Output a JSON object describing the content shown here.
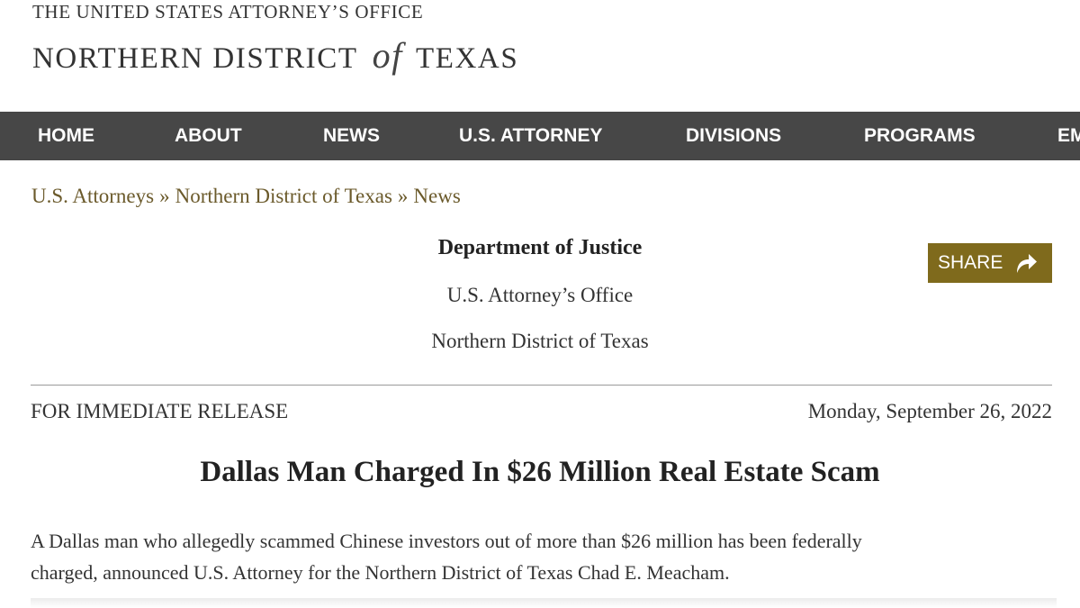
{
  "header": {
    "office_line": "THE UNITED STATES ATTORNEY’S OFFICE",
    "district_before": "NORTHERN DISTRICT",
    "district_of": "of",
    "district_after": "TEXAS"
  },
  "nav": {
    "items": [
      {
        "label": "HOME"
      },
      {
        "label": "ABOUT"
      },
      {
        "label": "NEWS"
      },
      {
        "label": "U.S. ATTORNEY"
      },
      {
        "label": "DIVISIONS"
      },
      {
        "label": "PROGRAMS"
      },
      {
        "label": "EM"
      }
    ]
  },
  "breadcrumb": {
    "items": [
      "U.S. Attorneys",
      "Northern District of Texas",
      "News"
    ],
    "separator": "»"
  },
  "agency": {
    "title": "Department of Justice",
    "office": "U.S. Attorney’s Office",
    "district": "Northern District of Texas"
  },
  "share": {
    "label": "SHARE",
    "icon": "share-arrow-icon",
    "color": "#7f6a1c"
  },
  "release": {
    "label": "FOR IMMEDIATE RELEASE",
    "date": "Monday, September 26, 2022"
  },
  "article": {
    "headline": "Dallas Man Charged In $26 Million Real Estate Scam",
    "lines": [
      "A Dallas man who allegedly scammed Chinese investors out of more than $26 million has been federally",
      "charged, announced U.S. Attorney for the Northern District of Texas Chad E. Meacham."
    ]
  },
  "colors": {
    "nav_bg": "#474747",
    "link": "#6b5a2b",
    "accent": "#7f6a1c"
  }
}
